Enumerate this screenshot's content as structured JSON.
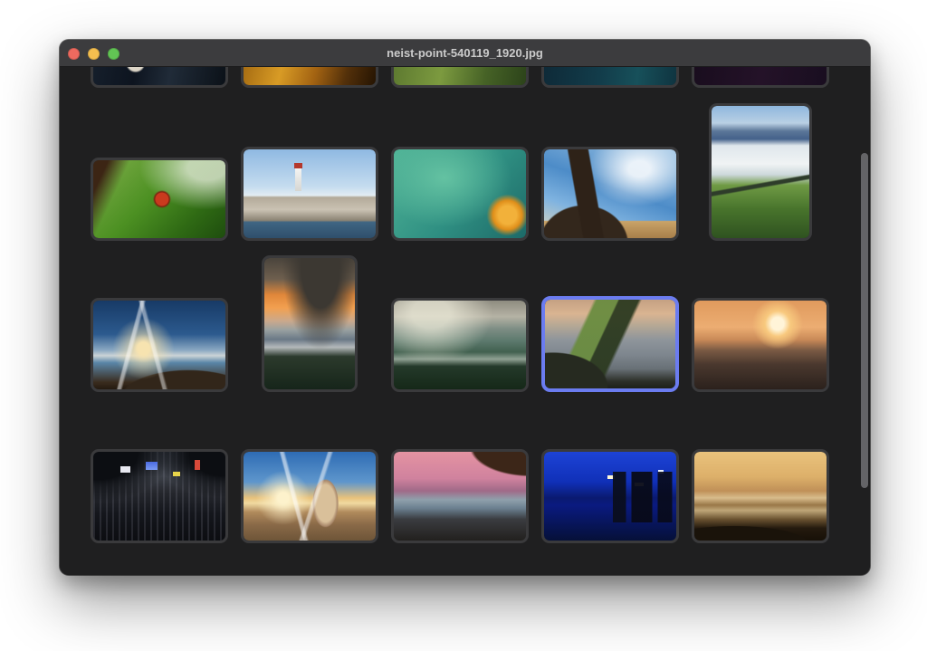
{
  "window": {
    "title": "neist-point-540119_1920.jpg",
    "traffic_lights": [
      {
        "id": "close",
        "color": "#ee6a5f"
      },
      {
        "id": "minimize",
        "color": "#f5bf4f"
      },
      {
        "id": "zoom",
        "color": "#62c554"
      }
    ]
  },
  "colors": {
    "titlebar_bg": "#3c3c3e",
    "window_bg": "#1f1f20",
    "thumb_frame": "#3a3a3c",
    "selection_border": "#6b7cf0",
    "scrollbar_thumb": "#717174",
    "title_text": "#cbcbcb"
  },
  "grid": {
    "rows": [
      {
        "items": [
          {
            "id": "dashboard-figurine",
            "label": "snowman figurine on dark dashboard (partially scrolled out of view)",
            "shape": "tall",
            "selected": false
          },
          {
            "id": "orange-flowers",
            "label": "orange flowers on amber background (partially scrolled out of view)",
            "shape": "tall",
            "selected": false
          },
          {
            "id": "dewy-grass",
            "label": "green grass with dew bokeh (partially scrolled out of view)",
            "shape": "tall",
            "selected": false
          },
          {
            "id": "teal-sea",
            "label": "dark teal sea texture (partially scrolled out of view)",
            "shape": "tall",
            "selected": false
          },
          {
            "id": "purple-flower",
            "label": "purple flower on dark background (partially scrolled out of view)",
            "shape": "tall",
            "selected": false
          }
        ]
      },
      {
        "items": [
          {
            "id": "ladybug-leaf",
            "label": "ladybug on green leaf",
            "shape": "short",
            "selected": false
          },
          {
            "id": "lighthouse-coast",
            "label": "white lighthouse on rocky coast",
            "shape": "landscape",
            "selected": false
          },
          {
            "id": "teal-flower",
            "label": "orange flower on teal background",
            "shape": "landscape",
            "selected": false
          },
          {
            "id": "desert-butte",
            "label": "desert rock butte under blue sky",
            "shape": "landscape",
            "selected": false
          },
          {
            "id": "mountain-road",
            "label": "green mountain ridge road above clouds",
            "shape": "portrait34",
            "selected": false
          }
        ]
      },
      {
        "items": [
          {
            "id": "summit-contrails",
            "label": "mountain summit with sun and contrails",
            "shape": "landscape",
            "selected": false
          },
          {
            "id": "sunset-valley",
            "label": "orange sunset over foggy forest valley",
            "shape": "portrait23",
            "selected": false
          },
          {
            "id": "misty-mountains",
            "label": "misty layered mountain valley",
            "shape": "landscape",
            "selected": false
          },
          {
            "id": "neist-point",
            "label": "Neist Point cliffs and lighthouse at dusk (selected)",
            "shape": "landscape",
            "selected": true
          },
          {
            "id": "ocean-waves",
            "label": "ocean waves at sunset",
            "shape": "landscape",
            "selected": false
          }
        ]
      },
      {
        "items": [
          {
            "id": "shibuya-crossing",
            "label": "busy city crossing at night",
            "shape": "landscape",
            "selected": false
          },
          {
            "id": "stone-cairn",
            "label": "stacked stone cairn at sunset",
            "shape": "landscape",
            "selected": false
          },
          {
            "id": "pink-cave",
            "label": "pink sky seen from coastal cave",
            "shape": "landscape",
            "selected": false
          },
          {
            "id": "skyline-night",
            "label": "city skyline reflected at blue hour",
            "shape": "landscape",
            "selected": false
          },
          {
            "id": "golden-mist",
            "label": "golden misty hills with tree silhouettes",
            "shape": "landscape",
            "selected": false
          }
        ]
      }
    ]
  }
}
